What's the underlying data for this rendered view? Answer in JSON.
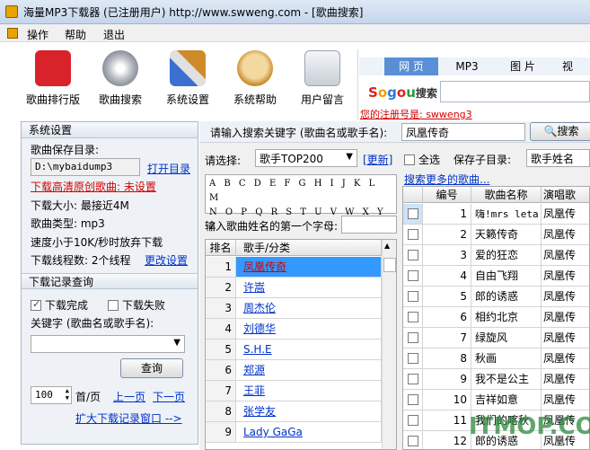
{
  "window": {
    "title": "海量MP3下载器 (已注册用户) http://www.swweng.com - [歌曲搜索]"
  },
  "menu": [
    "操作",
    "帮助",
    "退出"
  ],
  "toolbar": [
    {
      "label": "歌曲排行版",
      "icon": "chart-book-icon",
      "color": "#d9232b"
    },
    {
      "label": "歌曲搜索",
      "icon": "music-disc-icon",
      "color": "#8a8f99"
    },
    {
      "label": "系统设置",
      "icon": "tools-icon",
      "color": "#3b6fd0"
    },
    {
      "label": "系统帮助",
      "icon": "help-robot-icon",
      "color": "#c98a2a"
    },
    {
      "label": "用户留言",
      "icon": "message-pen-icon",
      "color": "#9aa4b0"
    }
  ],
  "sogou": {
    "tabs": [
      "网 页",
      "MP3",
      "图 片",
      "视"
    ],
    "logo": "Sogou搜索",
    "registration": "您的注册号是: swweng3"
  },
  "system_settings": {
    "header": "系统设置",
    "save_dir_label": "歌曲保存目录:",
    "save_dir_value": "D:\\mybaidump3",
    "open_dir": "打开目录",
    "hq_download": "下载高清原创歌曲: 未设置",
    "download_size": "下载大小: 最接近4M",
    "song_type": "歌曲类型: mp3",
    "speed_rule": "速度小于10K/秒时放弃下载",
    "threads": "下载线程数: 2个线程",
    "change_settings": "更改设置"
  },
  "download_history": {
    "header": "下载记录查询",
    "done_label": "下载完成",
    "done_checked": true,
    "fail_label": "下载失败",
    "fail_checked": false,
    "keyword_label": "关键字 (歌曲名或歌手名):",
    "query_button": "查询",
    "page_size": "100",
    "per_page": "首/页",
    "prev_page": "上一页",
    "next_page": "下一页",
    "expand_link": "扩大下载记录窗口 -->"
  },
  "search": {
    "prompt": "请输入搜索关键字 (歌曲名或歌手名):",
    "value": "凤凰传奇",
    "button": "搜索"
  },
  "filter": {
    "select_label": "请选择:",
    "select_value": "歌手TOP200",
    "update_link": "[更新]",
    "select_all": "全选",
    "save_subdir_label": "保存子目录:",
    "save_subdir_value": "歌手姓名",
    "more_link": "搜索更多的歌曲..."
  },
  "alphabet": [
    "A B C D E F G H I J K L M",
    "N O P Q R S T U V W X Y Z"
  ],
  "first_letter_label": "输入歌曲姓名的第一个字母:",
  "singers": {
    "columns": [
      "排名",
      "歌手/分类"
    ],
    "rows": [
      {
        "rank": "1",
        "name": "凤凰传奇"
      },
      {
        "rank": "2",
        "name": "许嵩"
      },
      {
        "rank": "3",
        "name": "周杰伦"
      },
      {
        "rank": "4",
        "name": "刘德华"
      },
      {
        "rank": "5",
        "name": "S.H.E"
      },
      {
        "rank": "6",
        "name": "郑源"
      },
      {
        "rank": "7",
        "name": "王菲"
      },
      {
        "rank": "8",
        "name": "张学友"
      },
      {
        "rank": "9",
        "name": "Lady GaGa"
      }
    ]
  },
  "songs": {
    "columns": [
      "编号",
      "歌曲名称",
      "演唱歌"
    ],
    "rows": [
      {
        "no": "1",
        "title": "嗨!mrs leta",
        "artist": "凤凰传"
      },
      {
        "no": "2",
        "title": "天籁传奇",
        "artist": "凤凰传"
      },
      {
        "no": "3",
        "title": "爱的狂恋",
        "artist": "凤凰传"
      },
      {
        "no": "4",
        "title": "自由飞翔",
        "artist": "凤凰传"
      },
      {
        "no": "5",
        "title": "郎的诱惑",
        "artist": "凤凰传"
      },
      {
        "no": "6",
        "title": "相约北京",
        "artist": "凤凰传"
      },
      {
        "no": "7",
        "title": "绿旋风",
        "artist": "凤凰传"
      },
      {
        "no": "8",
        "title": "秋画",
        "artist": "凤凰传"
      },
      {
        "no": "9",
        "title": "我不是公主",
        "artist": "凤凰传"
      },
      {
        "no": "10",
        "title": "吉祥如意",
        "artist": "凤凰传"
      },
      {
        "no": "11",
        "title": "我们的喀秋",
        "artist": "凤凰传"
      },
      {
        "no": "12",
        "title": "郎的诱惑",
        "artist": "凤凰传"
      }
    ]
  },
  "watermark": "ITMOP.COM"
}
